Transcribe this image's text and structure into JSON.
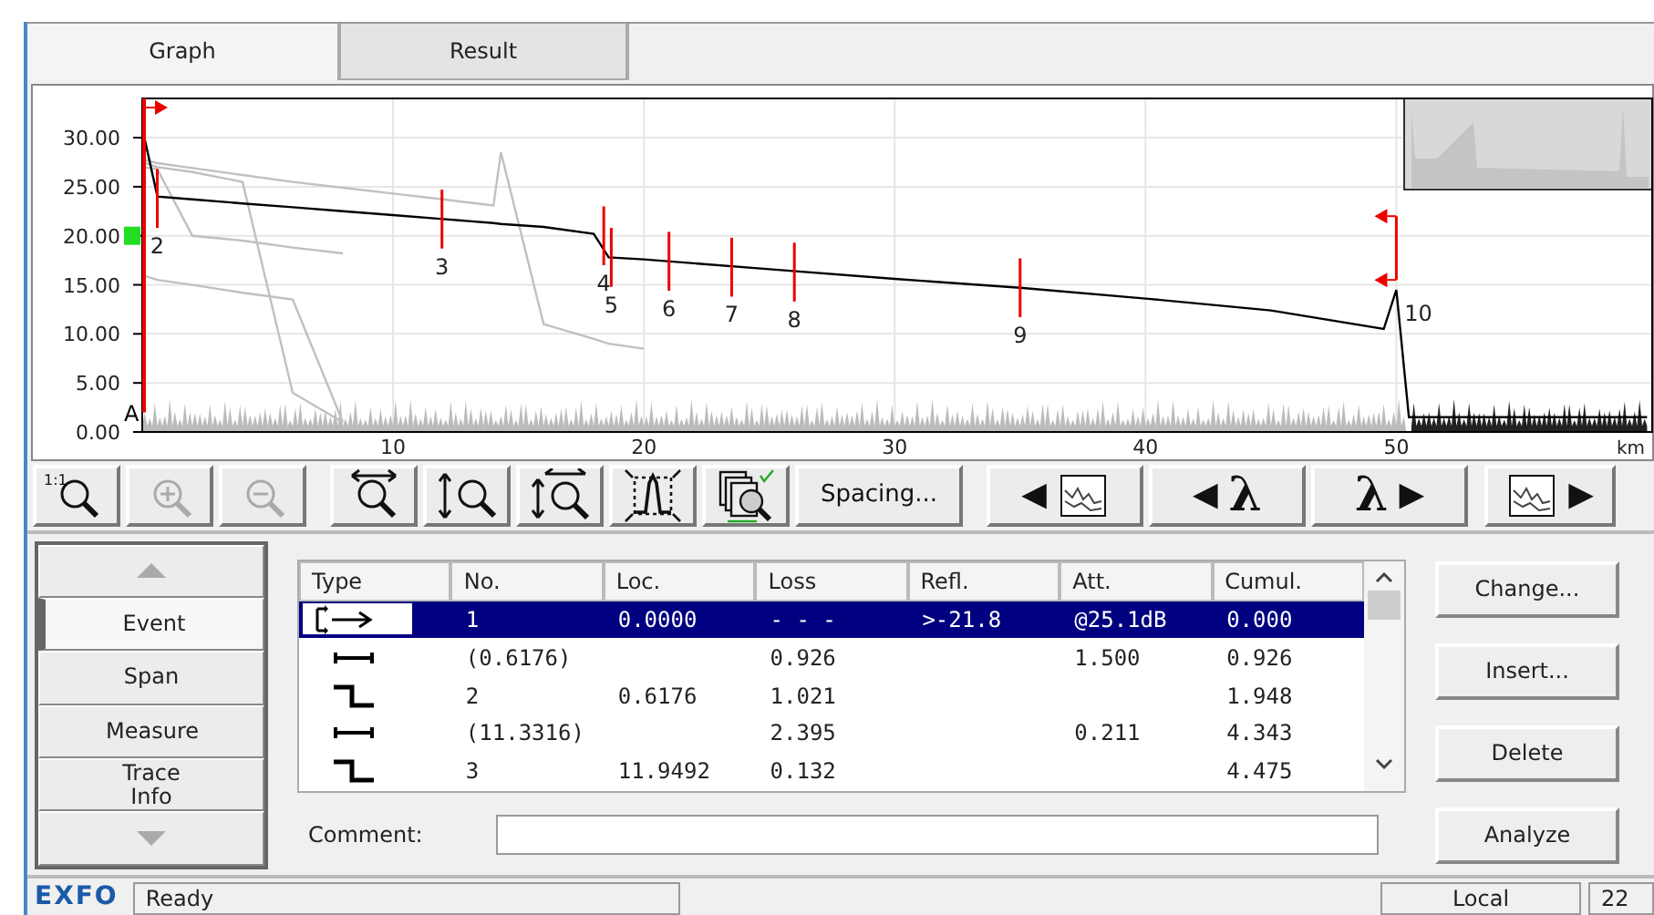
{
  "tabs": [
    {
      "label": "Graph",
      "selected": true
    },
    {
      "label": "Result",
      "selected": false
    }
  ],
  "graph": {
    "chart_data": {
      "type": "line",
      "xlabel": "km",
      "x": [
        0,
        0.6,
        2,
        4,
        6,
        8,
        10,
        12,
        14,
        14.3,
        16,
        18,
        18.6,
        20,
        25,
        30,
        35,
        40,
        45,
        49.5,
        50,
        50.5,
        55,
        60
      ],
      "series": [
        {
          "color": "#c0c0c0",
          "values": [
            16,
            15.5,
            15,
            14.2,
            13.5,
            1,
            null,
            null,
            null,
            null,
            null,
            null,
            null,
            null,
            null,
            null,
            null,
            null,
            null,
            null,
            null,
            null,
            null,
            null
          ]
        },
        {
          "color": "#c0c0c0",
          "values": [
            27,
            26.8,
            20,
            19.5,
            18.8,
            18.2,
            null,
            null,
            null,
            null,
            null,
            null,
            null,
            null,
            null,
            null,
            null,
            null,
            null,
            null,
            null,
            null,
            null,
            null
          ]
        },
        {
          "color": "#c0c0c0",
          "values": [
            27.5,
            27,
            26.5,
            25.5,
            4,
            1,
            null,
            null,
            null,
            null,
            null,
            null,
            null,
            null,
            null,
            null,
            null,
            null,
            null,
            null,
            null,
            null,
            null,
            null
          ]
        },
        {
          "color": "#c0c0c0",
          "values": [
            27.8,
            27.4,
            26.9,
            26.2,
            25.5,
            24.9,
            24.3,
            23.7,
            23.1,
            28.5,
            11,
            9.5,
            9,
            8.5,
            null,
            null,
            null,
            null,
            null,
            null,
            null,
            null,
            null,
            null
          ]
        },
        {
          "color": "#000000",
          "values": [
            31,
            24,
            23.7,
            23.3,
            22.9,
            22.5,
            22.1,
            21.7,
            21.3,
            21.2,
            20.9,
            20.2,
            17.8,
            17.6,
            16.6,
            15.6,
            14.7,
            13.6,
            12.4,
            10.5,
            14.5,
            1.5,
            1.5,
            1.5
          ]
        }
      ],
      "xlim": [
        0,
        60.2
      ],
      "ylim": [
        0,
        34
      ],
      "grid": true,
      "xticks": [
        10,
        20,
        30,
        40,
        50
      ],
      "yticks": [
        {
          "value": 0,
          "label": "0.00"
        },
        {
          "value": 5,
          "label": "5.00"
        },
        {
          "value": 10,
          "label": "10.00"
        },
        {
          "value": 15,
          "label": "15.00"
        },
        {
          "value": 20,
          "label": "20.00"
        },
        {
          "value": 25,
          "label": "25.00"
        },
        {
          "value": 30,
          "label": "30.00"
        }
      ],
      "annotations": [
        "A",
        {
          "x": 0.6,
          "y": 23.8,
          "text": "2"
        },
        {
          "x": 11.95,
          "y": 21.7,
          "text": "3"
        },
        {
          "x": 18.4,
          "y": 20,
          "text": "4"
        },
        {
          "x": 18.7,
          "y": 17.8,
          "text": "5"
        },
        {
          "x": 21,
          "y": 17.4,
          "text": "6"
        },
        {
          "x": 23.5,
          "y": 16.8,
          "text": "7"
        },
        {
          "x": 26,
          "y": 16.3,
          "text": "8"
        },
        {
          "x": 35,
          "y": 14.7,
          "text": "9"
        },
        {
          "x": 50,
          "y": 14.5,
          "text": "10"
        }
      ]
    }
  },
  "toolbar": [
    {
      "kind": "zoom-reset",
      "label": "1:1",
      "disabled": false
    },
    {
      "kind": "zoom-in",
      "disabled": true
    },
    {
      "kind": "zoom-out",
      "disabled": true
    },
    {
      "kind": "zoom-horizontal",
      "disabled": false
    },
    {
      "kind": "zoom-vertical",
      "disabled": false
    },
    {
      "kind": "zoom-both",
      "disabled": false
    },
    {
      "kind": "zoom-peak",
      "disabled": false
    },
    {
      "kind": "overlay",
      "disabled": false
    },
    {
      "kind": "text",
      "label": "Spacing...",
      "disabled": false
    },
    {
      "kind": "prev-trace",
      "arrow": "◀",
      "disabled": false
    },
    {
      "kind": "prev-wavelength",
      "arrow": "◀",
      "symbol": "λ",
      "disabled": false
    },
    {
      "kind": "next-wavelength",
      "arrow": "▶",
      "symbol": "λ",
      "disabled": false
    },
    {
      "kind": "next-trace",
      "arrow": "▶",
      "disabled": false
    }
  ],
  "side_nav": [
    {
      "kind": "up"
    },
    {
      "kind": "item",
      "label": "Event",
      "selected": true
    },
    {
      "kind": "item",
      "label": "Span",
      "selected": false
    },
    {
      "kind": "item",
      "label": "Measure",
      "selected": false
    },
    {
      "kind": "item",
      "label": "Trace Info",
      "selected": false
    },
    {
      "kind": "down"
    }
  ],
  "table": {
    "columns": [
      "Type",
      "No.",
      "Loc.",
      "Loss",
      "Refl.",
      "Att.",
      "Cumul."
    ],
    "rows": [
      {
        "kind": "launch",
        "selected": true,
        "cells": [
          "",
          "1",
          "0.0000",
          "- - -",
          ">-21.8",
          "@25.1dB",
          "0.000"
        ]
      },
      {
        "kind": "span",
        "selected": false,
        "cells": [
          "",
          "(0.6176)",
          "",
          "0.926",
          "",
          "1.500",
          "0.926"
        ]
      },
      {
        "kind": "event",
        "selected": false,
        "cells": [
          "",
          "2",
          "0.6176",
          "1.021",
          "",
          "",
          "1.948"
        ]
      },
      {
        "kind": "span",
        "selected": false,
        "cells": [
          "",
          "(11.3316)",
          "",
          "2.395",
          "",
          "0.211",
          "4.343"
        ]
      },
      {
        "kind": "event",
        "selected": false,
        "cells": [
          "",
          "3",
          "11.9492",
          "0.132",
          "",
          "",
          "4.475"
        ]
      }
    ]
  },
  "comment": {
    "label": "Comment:"
  },
  "buttons": [
    "Change...",
    "Insert...",
    "Delete",
    "Analyze"
  ],
  "status_bar": {
    "logo": "EXFO",
    "message": "Ready",
    "mode": "Local",
    "field_3": "22"
  }
}
